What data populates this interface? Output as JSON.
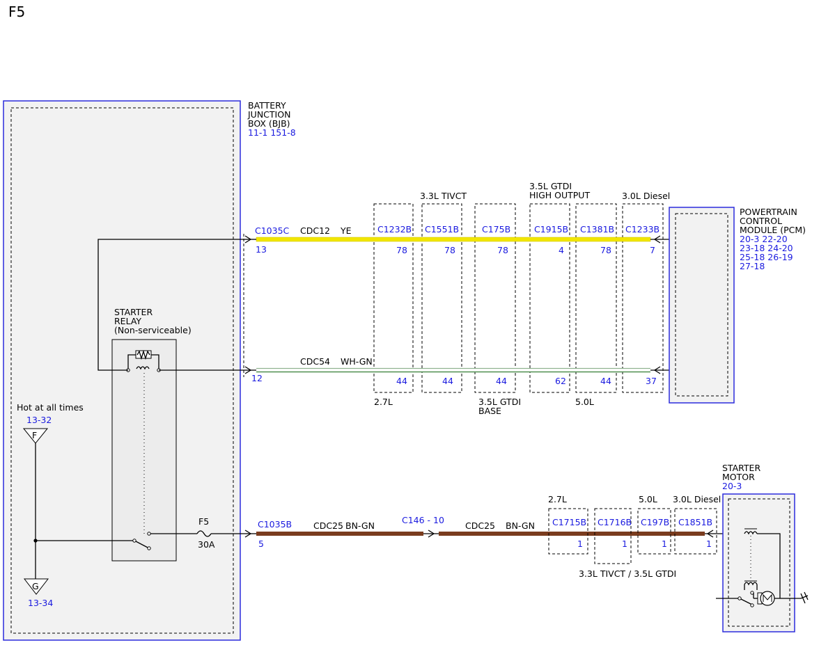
{
  "page": {
    "title": "F5"
  },
  "bjb": {
    "name_lines": [
      "BATTERY",
      "JUNCTION",
      "BOX (BJB)"
    ],
    "refs": "11-1   151-8"
  },
  "pcm": {
    "name_lines": [
      "POWERTRAIN",
      "CONTROL",
      "MODULE (PCM)"
    ],
    "refs": [
      "20-3   22-20",
      "23-18 24-20",
      "25-18 26-19",
      "27-18"
    ]
  },
  "starter_motor": {
    "name_lines": [
      "STARTER",
      "MOTOR"
    ],
    "ref": "20-3"
  },
  "relay": {
    "name_lines": [
      "STARTER",
      "RELAY",
      "(Non-serviceable)"
    ]
  },
  "hot": {
    "label": "Hot at all times",
    "ref": "13-32",
    "symbol": "F"
  },
  "ground": {
    "symbol": "G",
    "ref": "13-34"
  },
  "fuse": {
    "name": "F5",
    "rating": "30A"
  },
  "wire_top": {
    "connector": "C1035C",
    "pin": "13",
    "circuit": "CDC12",
    "color_code": "YE",
    "color": "#f2e600",
    "connectors": [
      {
        "name": "C1232B",
        "pin": "78"
      },
      {
        "name": "C1551B",
        "pin": "78"
      },
      {
        "name": "C175B",
        "pin": "78"
      },
      {
        "name": "C1915B",
        "pin": "4"
      },
      {
        "name": "C1381B",
        "pin": "78"
      },
      {
        "name": "C1233B",
        "pin": "7"
      }
    ]
  },
  "wire_mid": {
    "pin": "12",
    "circuit": "CDC54",
    "color_code": "WH-GN",
    "color": "#8fb38f",
    "pins": [
      "44",
      "44",
      "44",
      "62",
      "44",
      "37"
    ]
  },
  "variant_labels_top": {
    "tivct": "3.3L TIVCT",
    "gtdi_ho": [
      "3.5L GTDI",
      "HIGH OUTPUT"
    ],
    "diesel": "3.0L Diesel"
  },
  "variant_labels_bottom": {
    "l27": "2.7L",
    "gtdi_base": [
      "3.5L GTDI",
      "BASE"
    ],
    "l50": "5.0L"
  },
  "wire_bottom": {
    "connector": "C1035B",
    "pin": "5",
    "circuit": "CDC25",
    "color_code": "BN-GN",
    "color": "#7a3c1e",
    "splice": "C146 - 10",
    "circuit2": "CDC25",
    "color_code2": "BN-GN",
    "connectors": [
      {
        "name": "C1715B",
        "pin": "1"
      },
      {
        "name": "C1716B",
        "pin": "1"
      },
      {
        "name": "C197B",
        "pin": "1"
      },
      {
        "name": "C1851B",
        "pin": "1"
      }
    ],
    "variant_labels": {
      "l27": "2.7L",
      "l50": "5.0L",
      "diesel": "3.0L Diesel",
      "tivct_gtdi": "3.3L TIVCT / 3.5L GTDI"
    }
  },
  "colors": {
    "blue": "#1a1adf",
    "box_blue": "#2b2bdc"
  }
}
